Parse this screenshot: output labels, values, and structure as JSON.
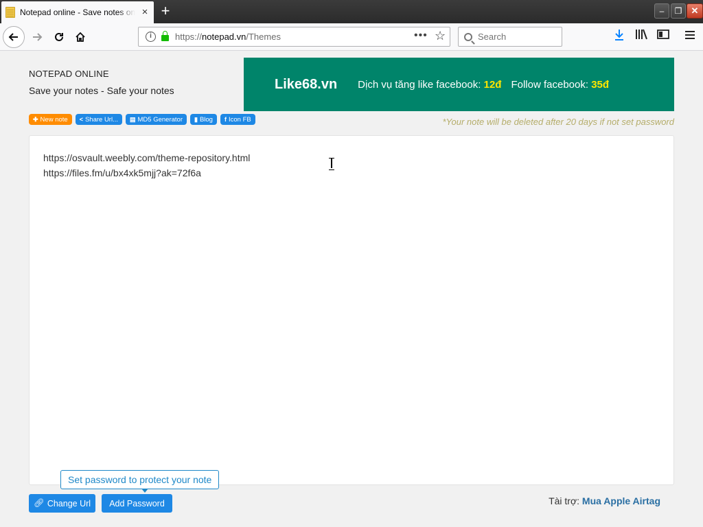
{
  "browser": {
    "tab_title": "Notepad online - Save notes online",
    "tab_close": "×",
    "new_tab": "+",
    "url_prefix": "https://",
    "url_host": "notepad.vn",
    "url_path": "/Themes",
    "url_more": "•••",
    "search_placeholder": "Search",
    "window_min": "–",
    "window_max": "❐",
    "window_close": "✕"
  },
  "header": {
    "brand": "NOTEPAD ONLINE",
    "tagline": "Save your notes - Safe your notes"
  },
  "ad": {
    "logo": "Like68.vn",
    "text1": "Dịch vụ tăng like facebook: ",
    "price1": "12đ",
    "text2": "Follow facebook: ",
    "price2": "35đ"
  },
  "toolbar": {
    "new_note": "New note",
    "share_url": "Share Url...",
    "md5": "MD5 Generator",
    "blog": "Blog",
    "icon_fb": "Icon FB",
    "notice": "*Your note will be deleted after 20 days if not set password"
  },
  "editor": {
    "lines": [
      "https://osvault.weebly.com/theme-repository.html",
      "https://files.fm/u/bx4xk5mjj?ak=72f6a"
    ]
  },
  "footer": {
    "tooltip": "Set password to protect your note",
    "change_url": "Change Url",
    "add_password": "Add Password",
    "sponsor_label": "Tài trợ: ",
    "sponsor_link": "Mua Apple Airtag"
  },
  "colors": {
    "ad_background": "#00846a",
    "ad_price": "#ffe600",
    "button_blue": "#1e88e5",
    "button_orange": "#ff8c00",
    "notice": "#b5ad6a"
  }
}
